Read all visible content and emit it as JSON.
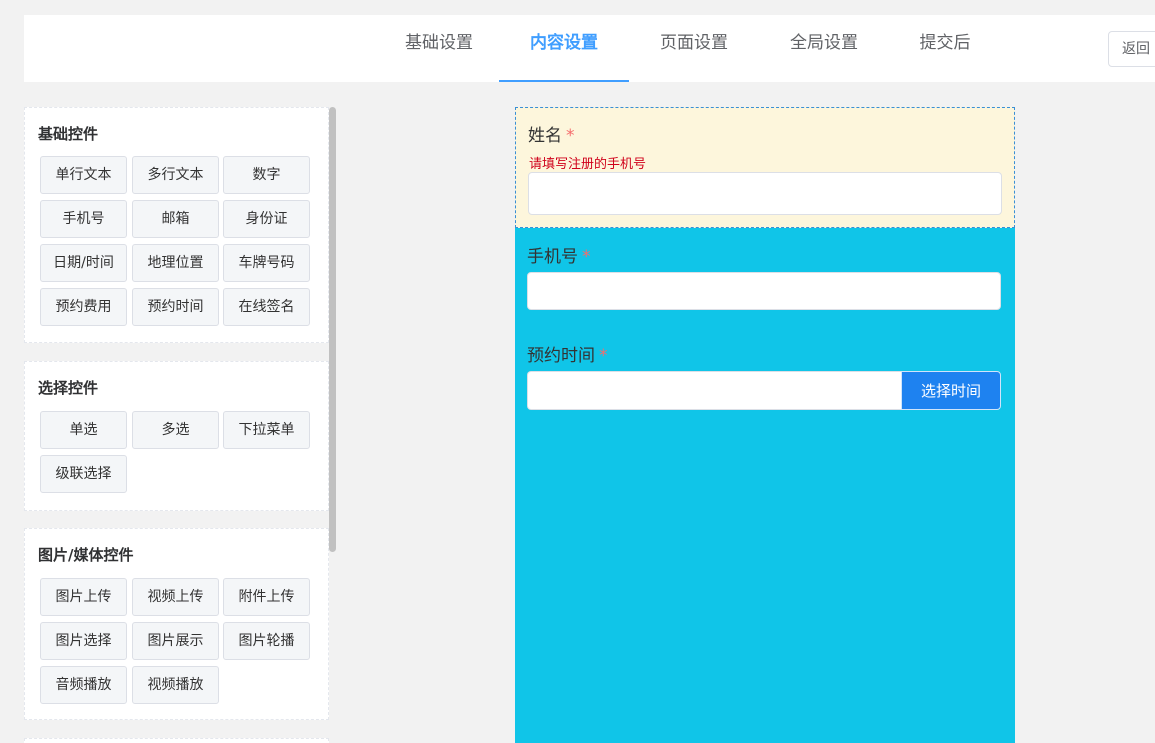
{
  "header": {
    "tabs": [
      {
        "label": "基础设置",
        "active": false
      },
      {
        "label": "内容设置",
        "active": true
      },
      {
        "label": "页面设置",
        "active": false
      },
      {
        "label": "全局设置",
        "active": false
      },
      {
        "label": "提交后",
        "active": false
      }
    ],
    "back_label": "返回",
    "accent_color": "#409eff"
  },
  "sidebar": {
    "groups": [
      {
        "title": "基础控件",
        "items": [
          "单行文本",
          "多行文本",
          "数字",
          "手机号",
          "邮箱",
          "身份证",
          "日期/时间",
          "地理位置",
          "车牌号码",
          "预约费用",
          "预约时间",
          "在线签名"
        ]
      },
      {
        "title": "选择控件",
        "items": [
          "单选",
          "多选",
          "下拉菜单",
          "级联选择"
        ]
      },
      {
        "title": "图片/媒体控件",
        "items": [
          "图片上传",
          "视频上传",
          "附件上传",
          "图片选择",
          "图片展示",
          "图片轮播",
          "音频播放",
          "视频播放"
        ]
      }
    ]
  },
  "form": {
    "background_color": "#10c5e8",
    "fields": [
      {
        "label": "姓名",
        "required_mark": "*",
        "hint": "请填写注册的手机号",
        "value": "",
        "selected": true
      },
      {
        "label": "手机号",
        "required_mark": "*",
        "value": ""
      },
      {
        "label": "预约时间",
        "required_mark": "*",
        "value": "",
        "button_label": "选择时间"
      }
    ]
  }
}
